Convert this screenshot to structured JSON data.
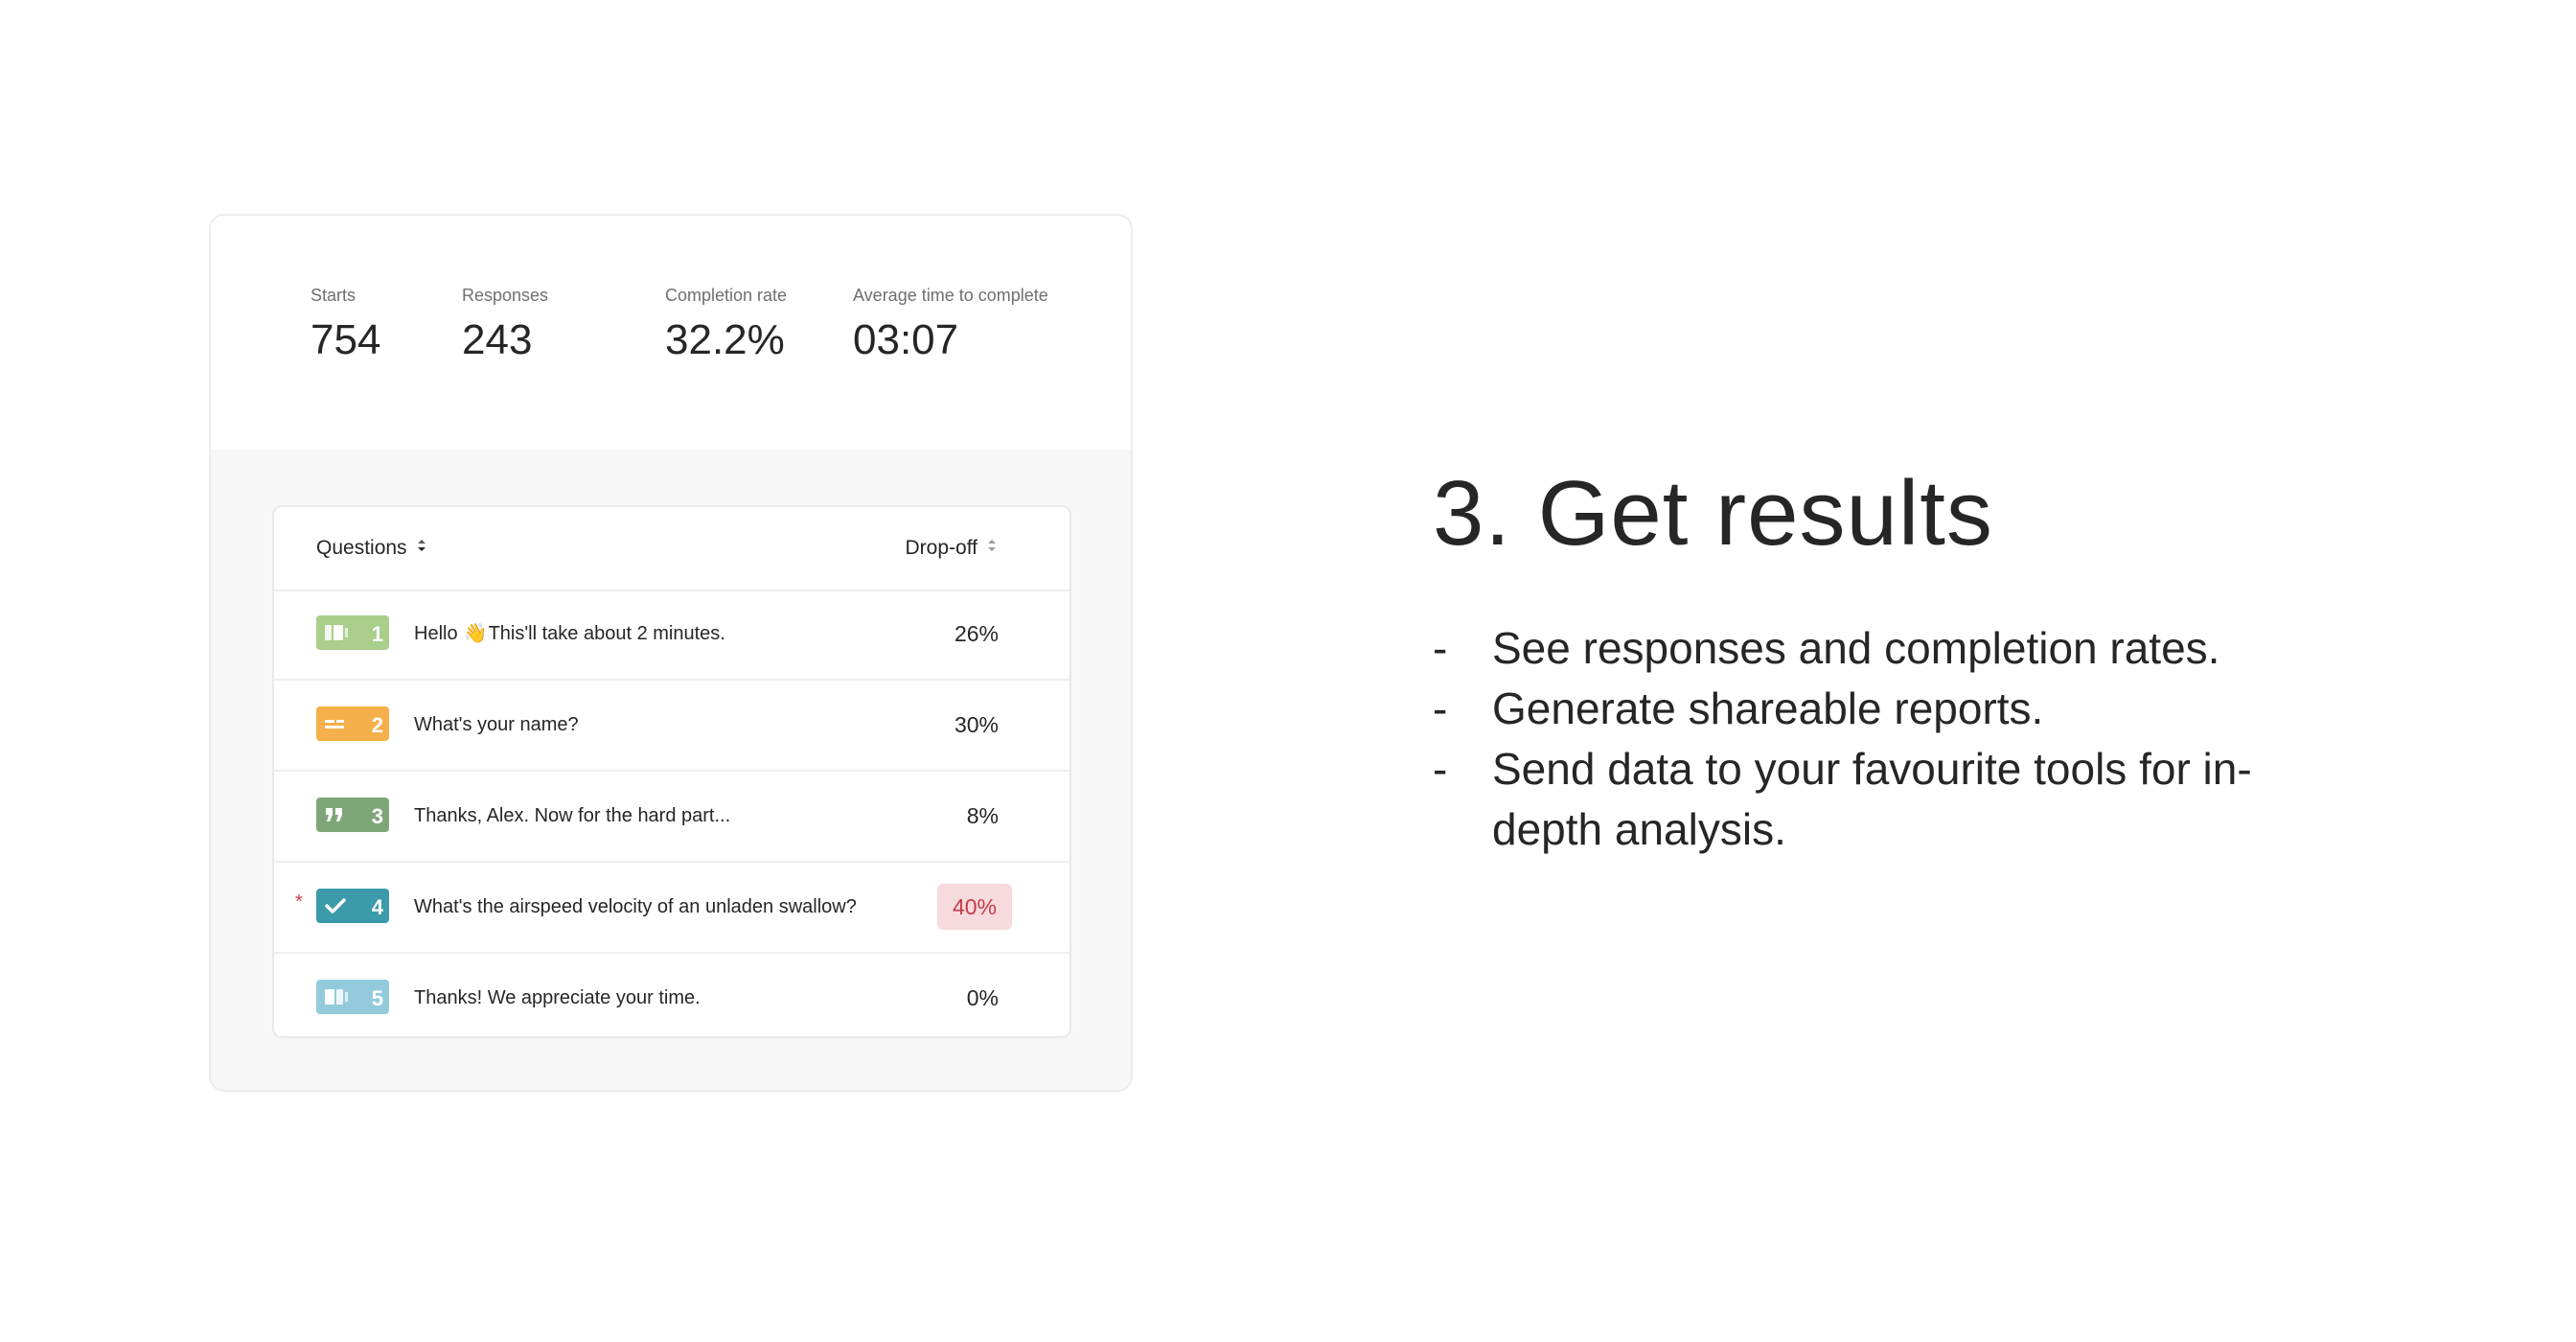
{
  "stats": [
    {
      "label": "Starts",
      "value": "754"
    },
    {
      "label": "Responses",
      "value": "243"
    },
    {
      "label": "Completion rate",
      "value": "32.2%"
    },
    {
      "label": "Average time to complete",
      "value": "03:07"
    }
  ],
  "table": {
    "header_questions": "Questions",
    "header_dropoff": "Drop-off",
    "rows": [
      {
        "number": "1",
        "icon": "welcome-screen-icon",
        "color": "#a9cf8a",
        "text_before": "Hello",
        "emoji": "👋",
        "text_after": "This'll take about 2 minutes.",
        "dropoff": "26%"
      },
      {
        "number": "2",
        "icon": "short-text-icon",
        "color": "#f5b04b",
        "text": "What's your name?",
        "dropoff": "30%"
      },
      {
        "number": "3",
        "icon": "quote-icon",
        "color": "#7fa679",
        "text": "Thanks, Alex. Now for the hard part...",
        "dropoff": "8%"
      },
      {
        "number": "4",
        "icon": "checkmark-icon",
        "color": "#3b9bab",
        "text": "What's the airspeed velocity of an unladen swallow?",
        "dropoff": "40%",
        "required_marker": "*"
      },
      {
        "number": "5",
        "icon": "end-screen-icon",
        "color": "#93cbdc",
        "text": "Thanks! We appreciate your time.",
        "dropoff": "0%"
      }
    ]
  },
  "headline": "3. Get results",
  "bullet_dash": "-",
  "bullets": [
    "See responses and completion rates.",
    "Generate shareable reports.",
    "Send data to your favourite tools for in-depth analysis."
  ],
  "colors": {
    "highlight_bg": "#f6dadd",
    "highlight_text": "#c43b4a",
    "required": "#d63a4b"
  }
}
